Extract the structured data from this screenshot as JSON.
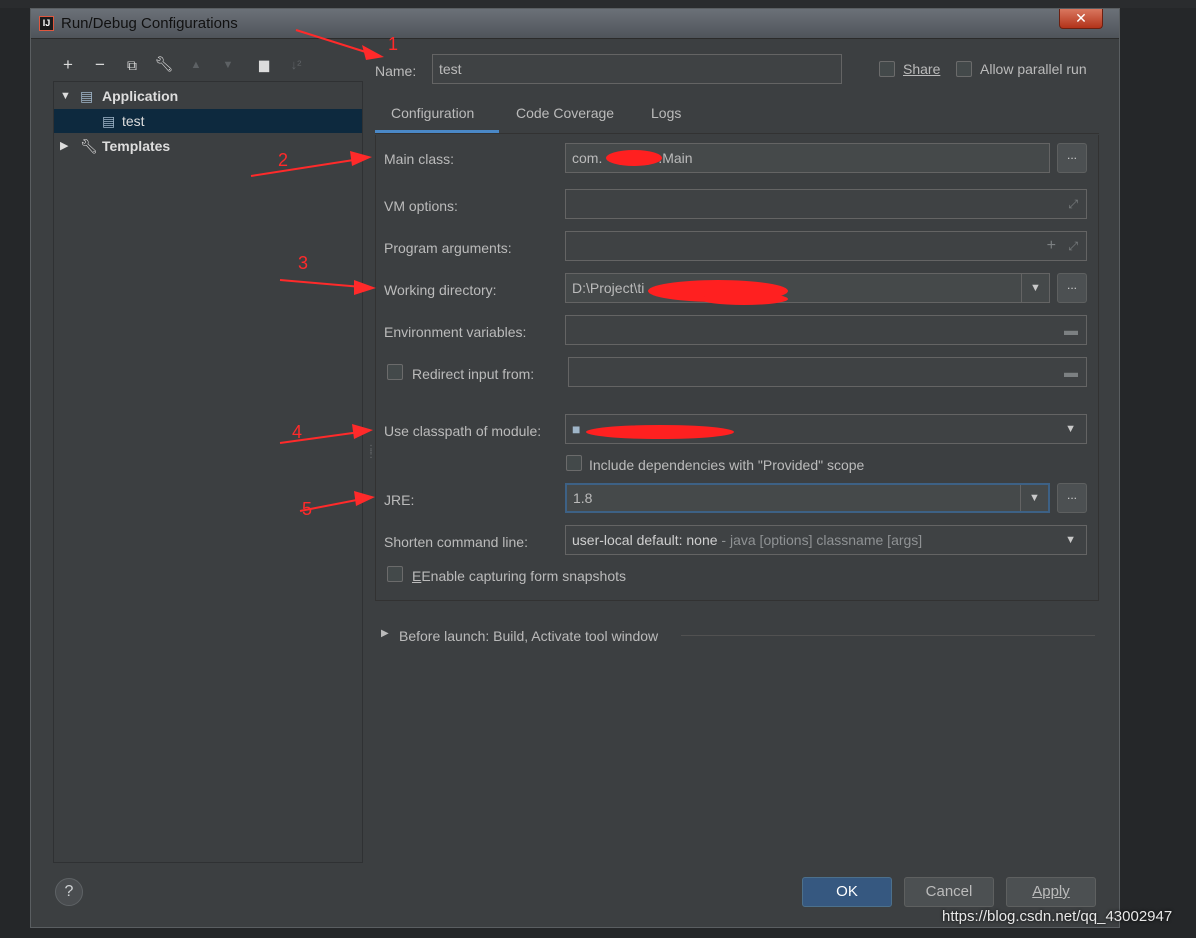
{
  "window": {
    "title": "Run/Debug Configurations",
    "close_glyph": "✕"
  },
  "tree_toolbar": {
    "icons": [
      "plus-icon",
      "minus-icon",
      "copy-icon",
      "wrench-icon",
      "arrow-up-icon",
      "arrow-down-icon",
      "folder-icon",
      "sort-icon"
    ]
  },
  "tree": {
    "items": [
      {
        "label": "Application",
        "icon": "application-icon",
        "expanded": true
      },
      {
        "label": "test",
        "icon": "run-config-icon",
        "selected": true
      },
      {
        "label": "Templates",
        "icon": "wrench-icon",
        "expanded": false
      }
    ]
  },
  "header": {
    "name_label": "Name:",
    "name_value": "test",
    "share_label": "Share",
    "parallel_label": "Allow parallel run"
  },
  "tabs": [
    {
      "label": "Configuration",
      "active": true
    },
    {
      "label": "Code Coverage",
      "active": false
    },
    {
      "label": "Logs",
      "active": false
    }
  ],
  "form": {
    "main_class": {
      "label": "Main class:",
      "value": "com.",
      "value_end": ".Main",
      "browse": "..."
    },
    "vm_options": {
      "label": "VM options:",
      "value": ""
    },
    "program_args": {
      "label": "Program arguments:",
      "value": ""
    },
    "working_dir": {
      "label": "Working directory:",
      "value": "D:\\Project\\ti",
      "browse": "..."
    },
    "env_vars": {
      "label": "Environment variables:",
      "value": ""
    },
    "redirect": {
      "label": "Redirect input from:",
      "value": ""
    },
    "classpath": {
      "label": "Use classpath of module:",
      "value": ""
    },
    "include_deps": {
      "label": "Include dependencies with \"Provided\" scope"
    },
    "jre": {
      "label": "JRE:",
      "value": "1.8",
      "browse": "..."
    },
    "shorten": {
      "label": "Shorten command line:",
      "value_main": "user-local default: none",
      "value_hint": " - java [options] classname [args]"
    },
    "snapshots": {
      "label": "Enable capturing form snapshots"
    }
  },
  "before_launch": {
    "label": "Before launch: Build, Activate tool window"
  },
  "buttons": {
    "help": "?",
    "ok": "OK",
    "cancel": "Cancel",
    "apply": "Apply"
  },
  "annotations": [
    "1",
    "2",
    "3",
    "4",
    "5"
  ],
  "watermark": "https://blog.csdn.net/qq_43002947",
  "colors": {
    "accent": "#4a88c7",
    "ok_button": "#365880",
    "annotation": "#ff2a2a",
    "background": "#3c3f41"
  }
}
